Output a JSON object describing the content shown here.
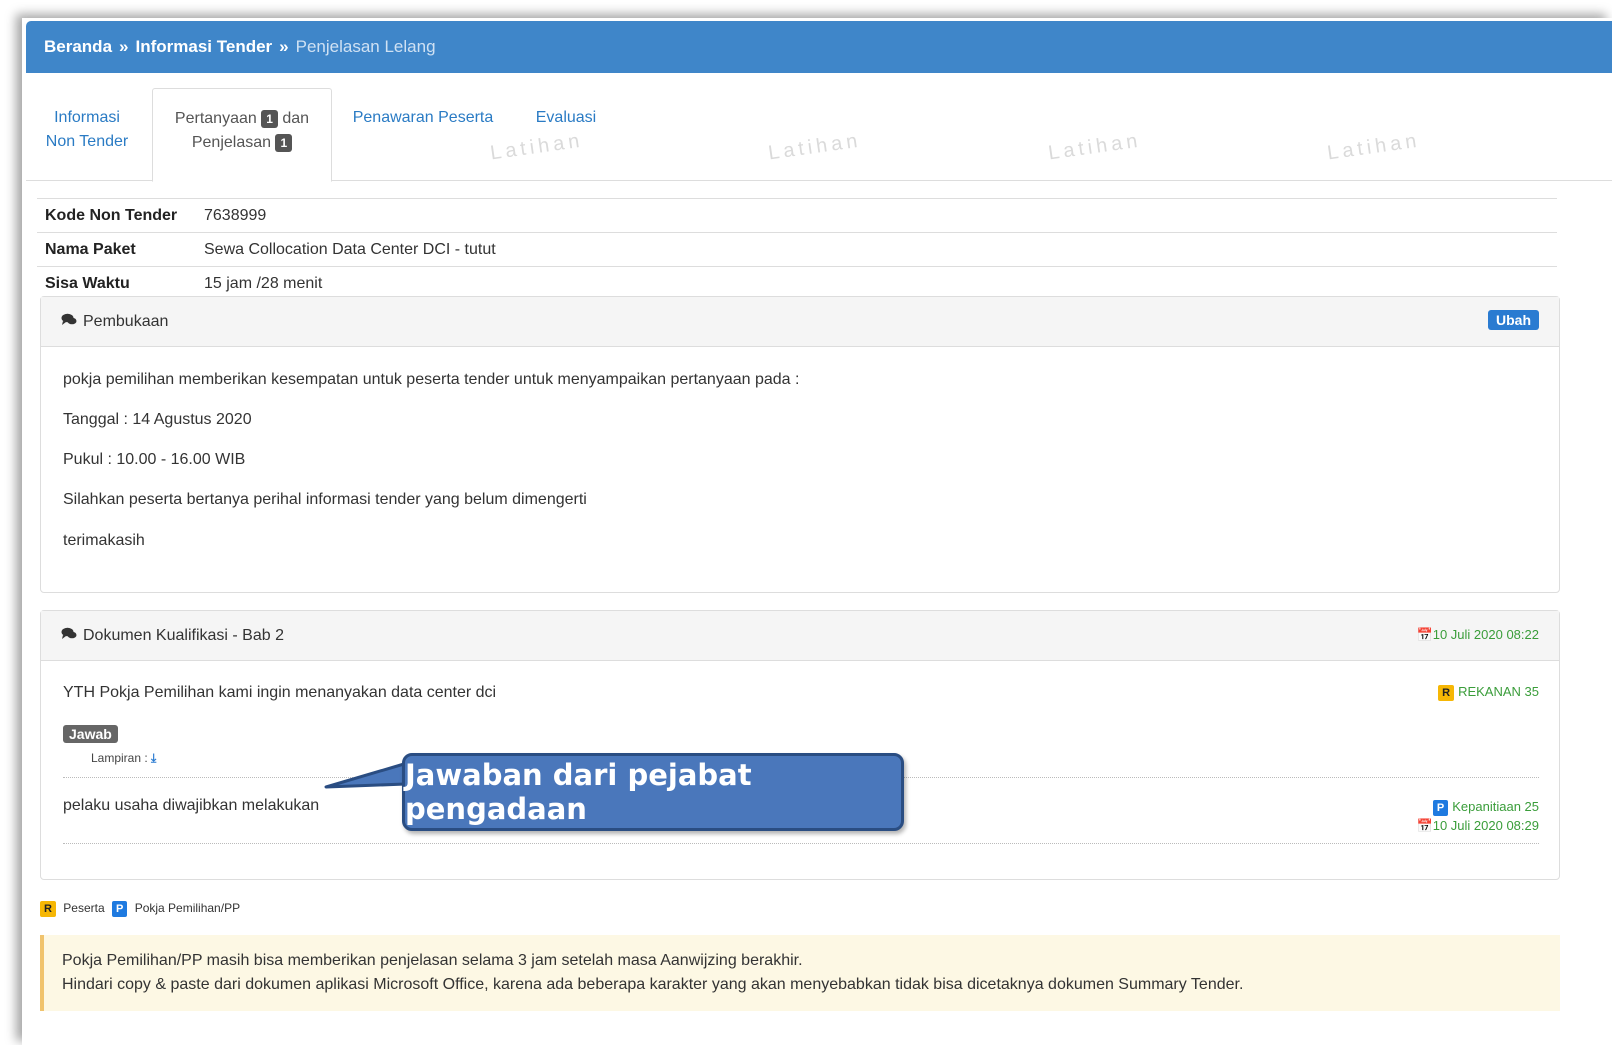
{
  "breadcrumb": {
    "home": "Beranda",
    "sep1": "»",
    "info": "Informasi Tender",
    "sep2": "»",
    "current": "Penjelasan Lelang"
  },
  "watermark": "Latihan",
  "tabs": {
    "informasi_line1": "Informasi",
    "informasi_line2": "Non Tender",
    "pertanyaan_line1_a": "Pertanyaan",
    "pertanyaan_badge1": "1",
    "pertanyaan_line1_b": "dan",
    "pertanyaan_line2": "Penjelasan",
    "pertanyaan_badge2": "1",
    "penawaran": "Penawaran Peserta",
    "evaluasi": "Evaluasi"
  },
  "info": {
    "kode_label": "Kode Non Tender",
    "kode_value": "7638999",
    "nama_label": "Nama Paket",
    "nama_value": "Sewa Collocation Data Center DCI - tutut",
    "sisa_label": "Sisa Waktu",
    "sisa_value": "15 jam /28 menit"
  },
  "pembukaan": {
    "title": "Pembukaan",
    "edit_label": "Ubah",
    "lines": [
      "pokja pemilihan memberikan kesempatan untuk peserta tender untuk menyampaikan pertanyaan pada :",
      "Tanggal : 14 Agustus 2020",
      "Pukul : 10.00 - 16.00 WIB",
      "Silahkan peserta bertanya perihal informasi tender yang belum dimengerti",
      "terimakasih"
    ]
  },
  "dokumen": {
    "title": "Dokumen Kualifikasi - Bab 2",
    "date": "10 Juli 2020 08:22",
    "question": "YTH Pokja Pemilihan kami ingin menanyakan data center dci",
    "question_author_badge": "R",
    "question_author": "REKANAN 35",
    "answer_label": "Jawab",
    "attachment_label": "Lampiran :",
    "answer_text": "pelaku usaha diwajibkan melakukan",
    "answer_author_badge": "P",
    "answer_author": "Kepanitiaan 25",
    "answer_date": "10 Juli 2020 08:29"
  },
  "legend": {
    "r_badge": "R",
    "r_label": "Peserta",
    "p_badge": "P",
    "p_label": "Pokja Pemilihan/PP"
  },
  "notice": {
    "line1": "Pokja Pemilihan/PP masih bisa memberikan penjelasan selama 3 jam setelah masa Aanwijzing berakhir.",
    "line2": "Hindari copy & paste dari dokumen aplikasi Microsoft Office, karena ada beberapa karakter yang akan menyebabkan tidak bisa dicetaknya dokumen Summary Tender."
  },
  "callout": {
    "text": "Jawaban dari pejabat pengadaan"
  },
  "colors": {
    "header_blue": "#3f86c9",
    "link_blue": "#2a7bc4",
    "badge_r": "#f6b705",
    "badge_p": "#1e7ae0",
    "date_green": "#3a9d3a",
    "callout_fill": "#4a77bb"
  }
}
